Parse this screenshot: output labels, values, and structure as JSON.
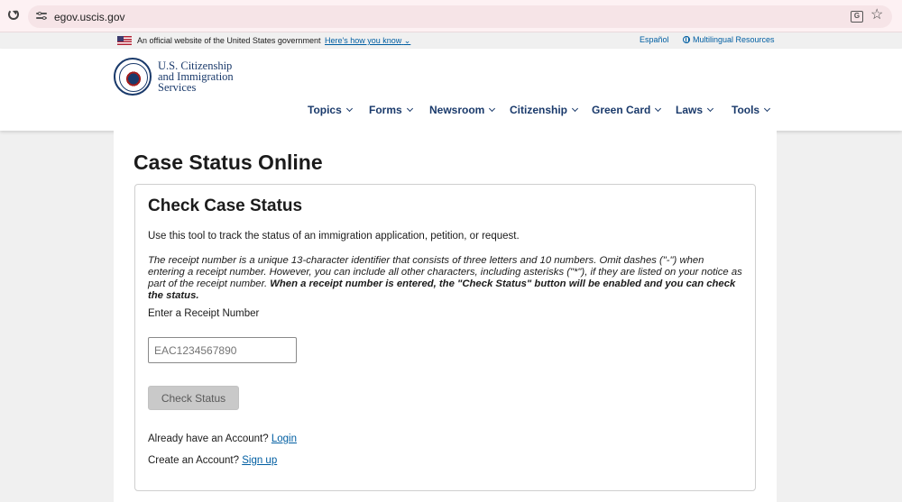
{
  "browser": {
    "url": "egov.uscis.gov"
  },
  "gov_banner": {
    "official_text": "An official website of the United States government",
    "how_link": "Here's how you know",
    "espanol": "Español",
    "multilingual": "Multilingual Resources"
  },
  "header": {
    "logo_line1": "U.S. Citizenship",
    "logo_line2": "and Immigration",
    "logo_line3": "Services",
    "nav": [
      "Topics",
      "Forms",
      "Newsroom",
      "Citizenship",
      "Green Card",
      "Laws",
      "Tools"
    ]
  },
  "main": {
    "page_title": "Case Status Online",
    "card_title": "Check Case Status",
    "intro": "Use this tool to track the status of an immigration application, petition, or request.",
    "note_italic": "The receipt number is a unique 13-character identifier that consists of three letters and 10 numbers. Omit dashes (\"-\") when entering a receipt number. However, you can include all other characters, including asterisks (\"*\"), if they are listed on your notice as part of the receipt number.",
    "note_bold": "When a receipt number is entered, the \"Check Status\" button will be enabled and you can check the status.",
    "field_label": "Enter a Receipt Number",
    "receipt_placeholder": "EAC1234567890",
    "receipt_value": "",
    "check_button": "Check Status",
    "account_text": "Already have an Account?",
    "login_link": "Login",
    "create_text": "Create an Account?",
    "signup_link": "Sign up"
  },
  "colors": {
    "link": "#005ea2",
    "brand_navy": "#1a3a6b",
    "disabled_button": "#c9c9c9"
  },
  "icons": [
    "reload-icon",
    "site-info-icon",
    "translate-icon",
    "star-icon",
    "us-flag-icon",
    "globe-icon",
    "dhs-seal-icon",
    "chevron-down-icon"
  ]
}
